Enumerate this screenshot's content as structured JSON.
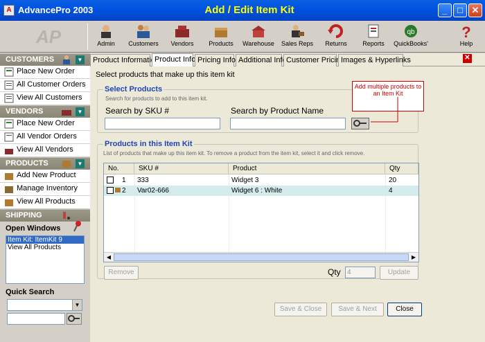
{
  "window": {
    "app_title": "AdvancePro 2003",
    "form_title": "Add / Edit Item Kit"
  },
  "toolbar": {
    "items": [
      {
        "label": "Admin",
        "icon": "admin-icon"
      },
      {
        "label": "Customers",
        "icon": "customers-icon"
      },
      {
        "label": "Vendors",
        "icon": "vendors-icon"
      },
      {
        "label": "Products",
        "icon": "products-icon"
      },
      {
        "label": "Warehouse",
        "icon": "warehouse-icon"
      },
      {
        "label": "Sales Reps",
        "icon": "sales-reps-icon"
      },
      {
        "label": "Returns",
        "icon": "returns-icon"
      },
      {
        "label": "Reports",
        "icon": "reports-icon"
      },
      {
        "label": "QuickBooks'",
        "icon": "quickbooks-icon"
      },
      {
        "label": "Help",
        "icon": "help-icon"
      }
    ]
  },
  "sidebar": {
    "customers": {
      "title": "CUSTOMERS",
      "items": [
        "Place New Order",
        "All Customer Orders",
        "View All Customers"
      ]
    },
    "vendors": {
      "title": "VENDORS",
      "items": [
        "Place New Order",
        "All Vendor Orders",
        "View All Vendors"
      ]
    },
    "products": {
      "title": "PRODUCTS",
      "items": [
        "Add New Product",
        "Manage Inventory",
        "View All Products"
      ]
    },
    "shipping": {
      "title": "SHIPPING"
    },
    "open_windows": {
      "title": "Open Windows",
      "items": [
        "Item Kit: ItemKit 9",
        "View All Products"
      ]
    },
    "quick_search": {
      "title": "Quick Search"
    }
  },
  "tabs": [
    "Product Information",
    "Product Info",
    "Pricing Info",
    "Additional Info",
    "Customer Pricing",
    "Images & Hyperlinks"
  ],
  "active_tab": 1,
  "panel": {
    "description": "Select products that make up this item kit",
    "select_products": {
      "title": "Select Products",
      "desc": "Search for products to add to this item kit.",
      "sku_label": "Search by SKU #",
      "name_label": "Search by Product Name",
      "sku_value": "",
      "name_value": ""
    },
    "callout": "Add multiple products to an Item Kit",
    "kit": {
      "title": "Products in this Item Kit",
      "desc": "List of products that make up this item kit. To remove a product from the item kit, select it and click remove.",
      "columns": [
        "No.",
        "SKU #",
        "Product",
        "Qty"
      ],
      "rows": [
        {
          "no": "1",
          "sku": "333",
          "product": "Widget 3",
          "qty": "20"
        },
        {
          "no": "2",
          "sku": "Var02-666",
          "product": "Widget 6 : White",
          "qty": "4"
        }
      ]
    },
    "remove_label": "Remove",
    "qty_label": "Qty",
    "qty_value": "4",
    "update_label": "Update",
    "save_close": "Save & Close",
    "save_next": "Save & Next",
    "close": "Close"
  }
}
